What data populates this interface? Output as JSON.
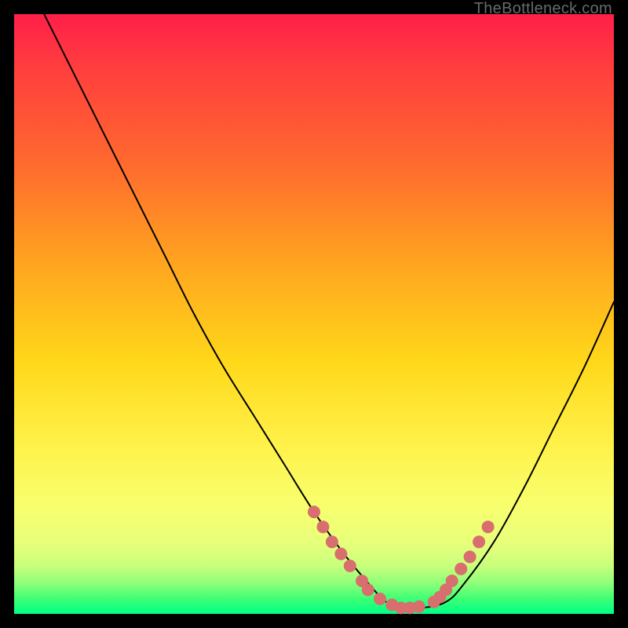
{
  "watermark": "TheBottleneck.com",
  "colors": {
    "dot": "#d86e6e",
    "curve": "#000000",
    "background": "#000000"
  },
  "chart_data": {
    "type": "line",
    "title": "",
    "xlabel": "",
    "ylabel": "",
    "xlim": [
      0,
      100
    ],
    "ylim": [
      0,
      100
    ],
    "grid": false,
    "legend": false,
    "series": [
      {
        "name": "bottleneck-curve",
        "x": [
          5,
          10,
          15,
          20,
          25,
          30,
          35,
          40,
          45,
          50,
          55,
          60,
          62,
          65,
          68,
          72,
          75,
          80,
          85,
          90,
          95,
          100
        ],
        "values": [
          100,
          90,
          80,
          70,
          60,
          50,
          41,
          33,
          25,
          17,
          10,
          4,
          2,
          1,
          1,
          2,
          5,
          12,
          21,
          31,
          41,
          52
        ]
      }
    ],
    "highlighted_points": {
      "name": "marker-dots",
      "x": [
        50,
        51.5,
        53,
        54.5,
        56,
        58,
        59,
        61,
        63,
        64.5,
        66,
        67.5,
        70,
        71,
        72,
        73,
        74.5,
        76,
        77.5,
        79
      ],
      "values": [
        17,
        14.5,
        12,
        10,
        8,
        5.5,
        4,
        2.5,
        1.5,
        1,
        1,
        1.2,
        2,
        2.8,
        4,
        5.5,
        7.5,
        9.5,
        12,
        14.5
      ]
    }
  }
}
